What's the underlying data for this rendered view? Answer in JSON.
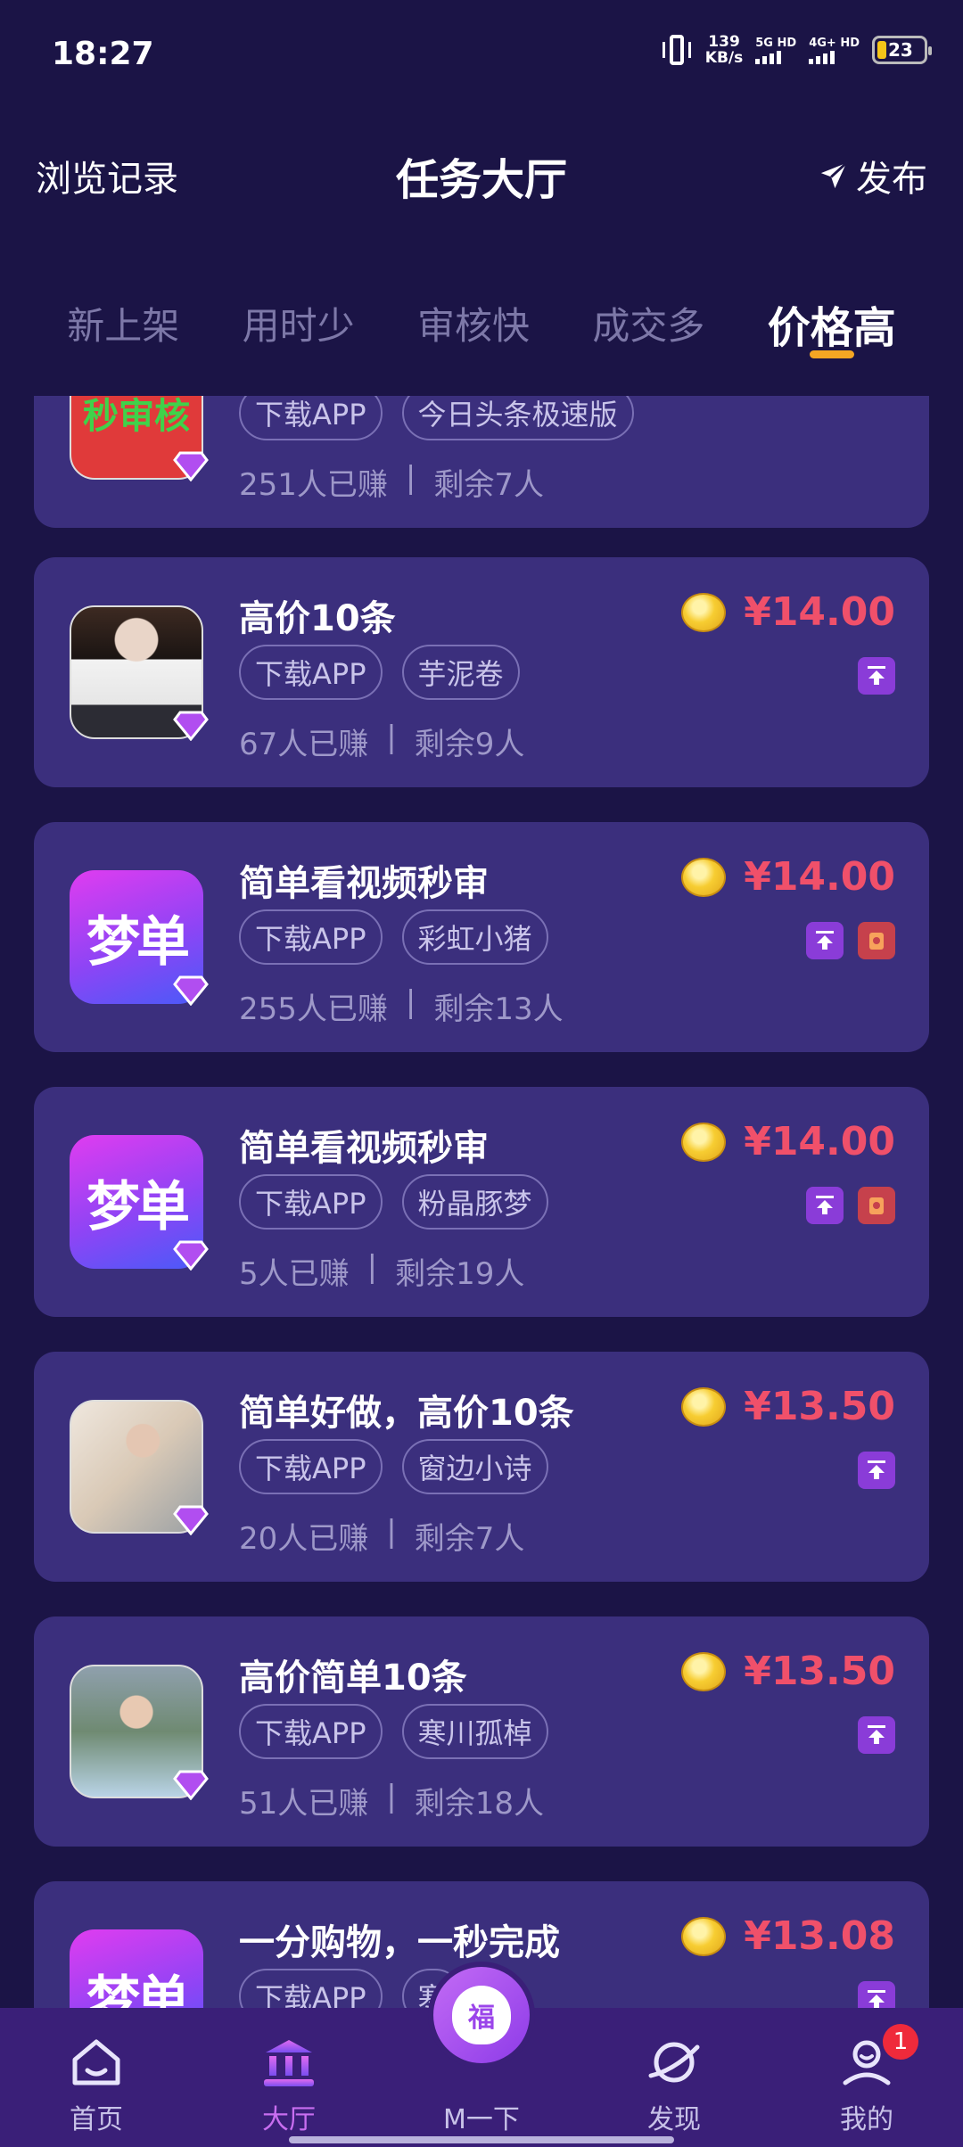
{
  "status": {
    "time": "18:27",
    "net_speed_value": "139",
    "net_speed_unit": "KB/s",
    "sim1": "5G HD",
    "sim2": "4G+ HD",
    "battery": "23"
  },
  "header": {
    "left": "浏览记录",
    "title": "任务大厅",
    "right": "发布"
  },
  "tabs": [
    {
      "label": "新上架",
      "active": false
    },
    {
      "label": "用时少",
      "active": false
    },
    {
      "label": "审核快",
      "active": false
    },
    {
      "label": "成交多",
      "active": false
    },
    {
      "label": "价格高",
      "active": true
    }
  ],
  "tasks": [
    {
      "title": "",
      "thumb_text": "秒审核",
      "tags": [
        "下载APP",
        "今日头条极速版"
      ],
      "earned": "251人已赚",
      "sep": "|",
      "remaining": "剩余7人",
      "price": "",
      "badges": []
    },
    {
      "title": "高价10条",
      "tags": [
        "下载APP",
        "芋泥卷"
      ],
      "earned": "67人已赚",
      "sep": "|",
      "remaining": "剩余9人",
      "price": "¥14.00",
      "badges": [
        "top"
      ]
    },
    {
      "title": "简单看视频秒审",
      "thumb_text": "梦单",
      "tags": [
        "下载APP",
        "彩虹小猪"
      ],
      "earned": "255人已赚",
      "sep": "|",
      "remaining": "剩余13人",
      "price": "¥14.00",
      "badges": [
        "top",
        "redpacket"
      ]
    },
    {
      "title": "简单看视频秒审",
      "thumb_text": "梦单",
      "tags": [
        "下载APP",
        "粉晶豚梦"
      ],
      "earned": "5人已赚",
      "sep": "|",
      "remaining": "剩余19人",
      "price": "¥14.00",
      "badges": [
        "top",
        "redpacket"
      ]
    },
    {
      "title": "简单好做，高价10条",
      "tags": [
        "下载APP",
        "窗边小诗"
      ],
      "earned": "20人已赚",
      "sep": "|",
      "remaining": "剩余7人",
      "price": "¥13.50",
      "badges": [
        "top"
      ]
    },
    {
      "title": "高价简单10条",
      "tags": [
        "下载APP",
        "寒川孤棹"
      ],
      "earned": "51人已赚",
      "sep": "|",
      "remaining": "剩余18人",
      "price": "¥13.50",
      "badges": [
        "top"
      ]
    },
    {
      "title": "一分购物，一秒完成",
      "thumb_text": "梦单",
      "tags": [
        "下载APP",
        "寒"
      ],
      "earned": "",
      "sep": "",
      "remaining": "",
      "price": "¥13.08",
      "badges": [
        "top"
      ]
    }
  ],
  "nav": {
    "home": "首页",
    "hall": "大厅",
    "center": "M一下",
    "center_icon_text": "福",
    "discover": "发现",
    "mine": "我的",
    "mine_badge": "1"
  }
}
